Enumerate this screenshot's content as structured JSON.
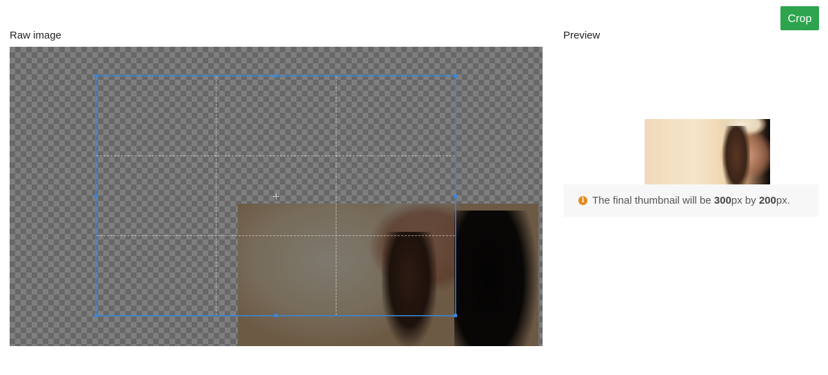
{
  "toolbar": {
    "crop_label": "Crop"
  },
  "raw": {
    "label": "Raw image"
  },
  "preview": {
    "label": "Preview",
    "info_prefix": "The final thumbnail will be ",
    "width_value": "300",
    "width_unit": "px by ",
    "height_value": "200",
    "height_unit": "px.",
    "info_icon": "info-icon"
  },
  "colors": {
    "accent_green": "#2ea44f",
    "crop_border": "#3b86d6",
    "info_icon": "#e98a1e"
  }
}
